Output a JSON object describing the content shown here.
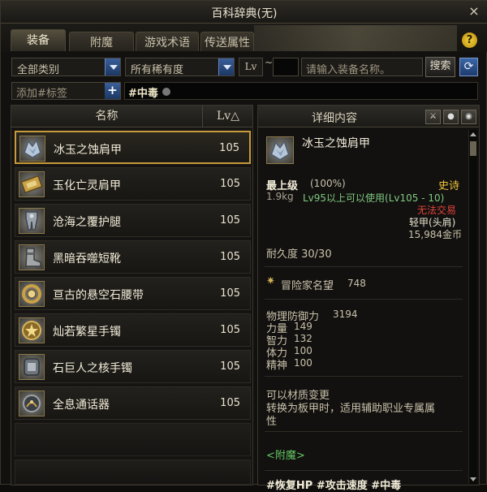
{
  "window": {
    "title": "百科辞典(无)",
    "close_glyph": "×"
  },
  "tabs": [
    {
      "label": "装备",
      "active": true
    },
    {
      "label": "附魔",
      "active": false
    },
    {
      "label": "游戏术语",
      "active": false
    },
    {
      "label": "传送属性",
      "active": false
    }
  ],
  "help_glyph": "?",
  "filters": {
    "category": "全部类别",
    "rarity": "所有稀有度",
    "lv_label": "Lv",
    "lv_sep": "~",
    "search_placeholder": "请输入装备名称。",
    "search_button": "搜索",
    "refresh_glyph": "⟳"
  },
  "tags": {
    "add_placeholder": "添加#标签",
    "add_glyph": "+",
    "active_tag": "#中毒"
  },
  "list": {
    "col_name": "名称",
    "col_lv": "Lv△",
    "items": [
      {
        "name": "冰玉之蚀肩甲",
        "lv": "105",
        "selected": true,
        "icon": "ice-shoulder-icon"
      },
      {
        "name": "玉化亡灵肩甲",
        "lv": "105",
        "selected": false,
        "icon": "undead-shoulder-icon"
      },
      {
        "name": "沧海之覆护腿",
        "lv": "105",
        "selected": false,
        "icon": "leg-armor-icon"
      },
      {
        "name": "黑暗吞噬短靴",
        "lv": "105",
        "selected": false,
        "icon": "boots-icon"
      },
      {
        "name": "亘古的悬空石腰带",
        "lv": "105",
        "selected": false,
        "icon": "belt-icon"
      },
      {
        "name": "灿若繁星手镯",
        "lv": "105",
        "selected": false,
        "icon": "star-bracelet-icon"
      },
      {
        "name": "石巨人之核手镯",
        "lv": "105",
        "selected": false,
        "icon": "golem-bracelet-icon"
      },
      {
        "name": "全息通话器",
        "lv": "105",
        "selected": false,
        "icon": "communicator-icon"
      }
    ]
  },
  "detail": {
    "header": "详细内容",
    "item_name": "冰玉之蚀肩甲",
    "grade": "最上级",
    "grade_pct": "(100%)",
    "rarity": "史诗",
    "weight": "1.9kg",
    "level_req": "Lv95以上可以使用(Lv105 - 10)",
    "trade": "无法交易",
    "type": "轻甲(头肩)",
    "price": "15,984金币",
    "durability": "耐久度 30/30",
    "fame_label": "冒险家名望",
    "fame_value": "748",
    "stats": [
      {
        "label": "物理防御力",
        "value": "3194"
      },
      {
        "label": "力量",
        "value": "149"
      },
      {
        "label": "智力",
        "value": "132"
      },
      {
        "label": "体力",
        "value": "100"
      },
      {
        "label": "精神",
        "value": "100"
      }
    ],
    "desc1": "可以材质变更",
    "desc2": "转换为板甲时，适用辅助职业专属属",
    "desc3": "性",
    "enchant": "<附魔>",
    "tags_line": "#恢复HP #攻击速度 #中毒"
  },
  "colors": {
    "rarity_epic": "#f0c43a",
    "level_req": "#7fc97f",
    "trade": "#e0443a",
    "enchant": "#62c662"
  }
}
